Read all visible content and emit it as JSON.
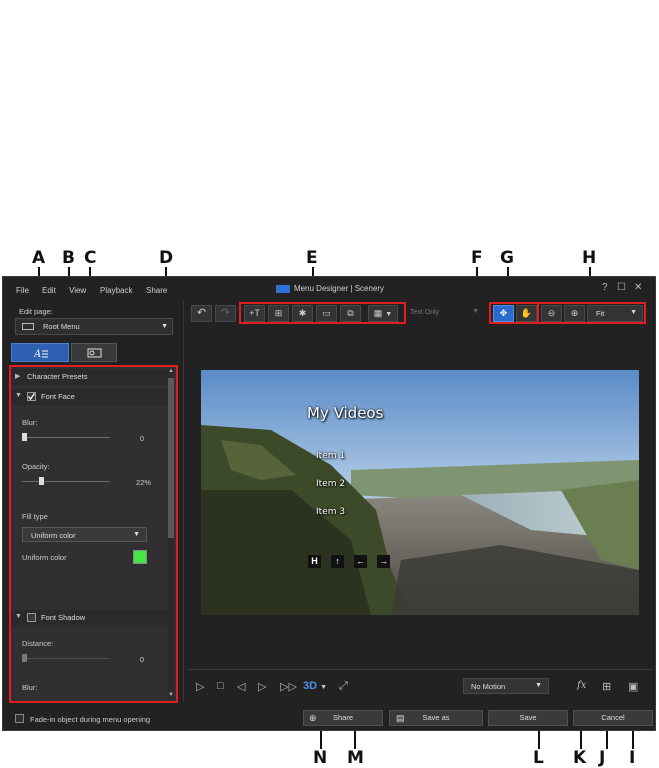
{
  "callouts": {
    "A": "A",
    "B": "B",
    "C": "C",
    "D": "D",
    "E": "E",
    "F": "F",
    "G": "G",
    "H": "H",
    "I": "I",
    "J": "J",
    "K": "K",
    "L": "L",
    "M": "M",
    "N": "N"
  },
  "menubar": {
    "file": "File",
    "edit": "Edit",
    "view": "View",
    "playback": "Playback",
    "share": "Share"
  },
  "window": {
    "title": "Menu Designer | Scenery",
    "help": "?",
    "maximize": "☐",
    "close": "✕"
  },
  "left_panel": {
    "edit_page_label": "Edit page:",
    "edit_page_value": "Root Menu",
    "sections": {
      "character_presets": "Character Presets",
      "font_face": "Font Face",
      "font_shadow": "Font Shadow"
    },
    "blur_label": "Blur:",
    "blur_value": "0",
    "blur_level": 0,
    "opacity_label": "Opacity:",
    "opacity_value": "22%",
    "opacity_level": 0.22,
    "fill_type_label": "Fill type",
    "fill_type_value": "Uniform color",
    "uniform_color_label": "Uniform color",
    "uniform_color": "#44e544",
    "distance_label": "Distance:",
    "distance_value": "0",
    "shadow_blur_label": "Blur:"
  },
  "toolbar": {
    "text_only_placeholder": "Text Only",
    "zoom_value": "Fit"
  },
  "preview": {
    "menu_title": "My Videos",
    "items": [
      "Item 1",
      "Item 2",
      "Item 3"
    ],
    "nav_buttons": [
      "H",
      "↑",
      "←",
      "→"
    ]
  },
  "bottom": {
    "motion_value": "No Motion",
    "threed_label": "3D",
    "fadein_label": "Fade-in object during menu opening",
    "share_label": "Share",
    "save_as_label": "Save as",
    "save_label": "Save",
    "cancel_label": "Cancel",
    "fx_label": "fx"
  },
  "colors": {
    "highlight": "#e02020",
    "active_tool": "#2a6bd0"
  }
}
